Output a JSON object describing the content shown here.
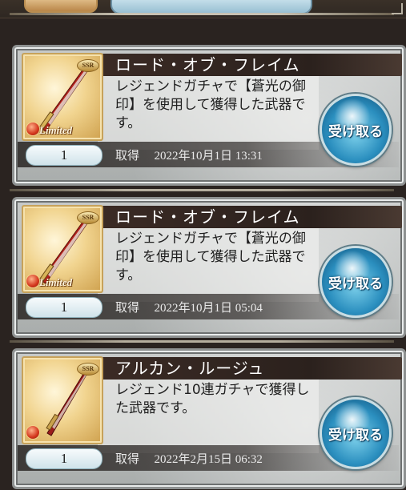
{
  "items": [
    {
      "title": "ロード・オブ・フレイム",
      "description": "レジェンドガチャで【蒼光の御印】を使用して獲得した武器です。",
      "quantity": "1",
      "acquired_label": "取得",
      "acquired_date": "2022年10月1日 13:31",
      "rarity": "SSR",
      "tag": "Limited",
      "button_label": "受け取る"
    },
    {
      "title": "ロード・オブ・フレイム",
      "description": "レジェンドガチャで【蒼光の御印】を使用して獲得した武器です。",
      "quantity": "1",
      "acquired_label": "取得",
      "acquired_date": "2022年10月1日 05:04",
      "rarity": "SSR",
      "tag": "Limited",
      "button_label": "受け取る"
    },
    {
      "title": "アルカン・ルージュ",
      "description": "レジェンド10連ガチャで獲得した武器です。",
      "quantity": "1",
      "acquired_label": "取得",
      "acquired_date": "2022年2月15日 06:32",
      "rarity": "SSR",
      "tag": "",
      "button_label": "受け取る"
    }
  ],
  "colors": {
    "button_blue": "#2b8fbf",
    "header_dark": "#2b211d",
    "frame_gold": "#c7a25a"
  }
}
